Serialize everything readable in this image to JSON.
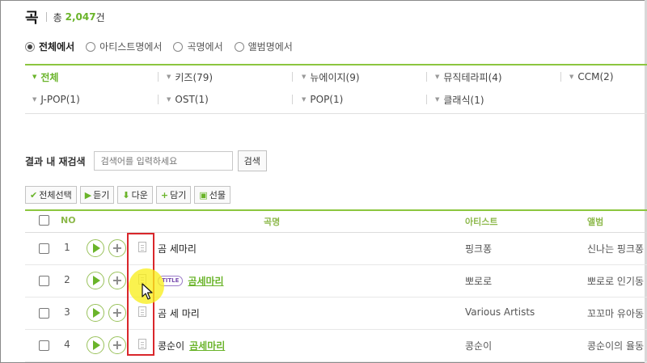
{
  "heading": {
    "title": "곡",
    "total_label": "총",
    "count": "2,047",
    "unit": "건"
  },
  "scope": {
    "options": [
      {
        "label": "전체에서",
        "checked": true
      },
      {
        "label": "아티스트명에서",
        "checked": false
      },
      {
        "label": "곡명에서",
        "checked": false
      },
      {
        "label": "앨범명에서",
        "checked": false
      }
    ]
  },
  "genres": [
    {
      "label": "전체",
      "active": true
    },
    {
      "label": "키즈(79)"
    },
    {
      "label": "뉴에이지(9)"
    },
    {
      "label": "뮤직테라피(4)"
    },
    {
      "label": "CCM(2)"
    },
    {
      "label": "J-POP(1)"
    },
    {
      "label": "OST(1)"
    },
    {
      "label": "POP(1)"
    },
    {
      "label": "클래식(1)"
    }
  ],
  "research": {
    "label": "결과 내 재검색",
    "placeholder": "검색어를 입력하세요",
    "button": "검색"
  },
  "toolbar": {
    "select_all": "전체선택",
    "listen": "듣기",
    "download": "다운",
    "add": "담기",
    "gift": "선물"
  },
  "table": {
    "headers": {
      "no": "NO",
      "song": "곡명",
      "artist": "아티스트",
      "album": "앨범"
    },
    "rows": [
      {
        "no": "1",
        "prefix": "",
        "badge": "",
        "title": "곰 세마리",
        "title_link": false,
        "artist": "핑크퐁",
        "album": "신나는 핑크퐁"
      },
      {
        "no": "2",
        "prefix": "",
        "badge": "TITLE",
        "title": "곰세마리",
        "title_link": true,
        "artist": "뽀로로",
        "album": "뽀로로 인기동"
      },
      {
        "no": "3",
        "prefix": "",
        "badge": "",
        "title": "곰 세 마리",
        "title_link": false,
        "artist": "Various Artists",
        "album": "꼬꼬마 유아동"
      },
      {
        "no": "4",
        "prefix": "콩순이",
        "badge": "",
        "title": "곰세마리",
        "title_link": true,
        "artist": "콩순이",
        "album": "콩순이의 율동"
      }
    ]
  },
  "colors": {
    "accent": "#6ab42a",
    "highlight_box": "#d9262b",
    "cursor_halo": "#f8ee1e"
  }
}
